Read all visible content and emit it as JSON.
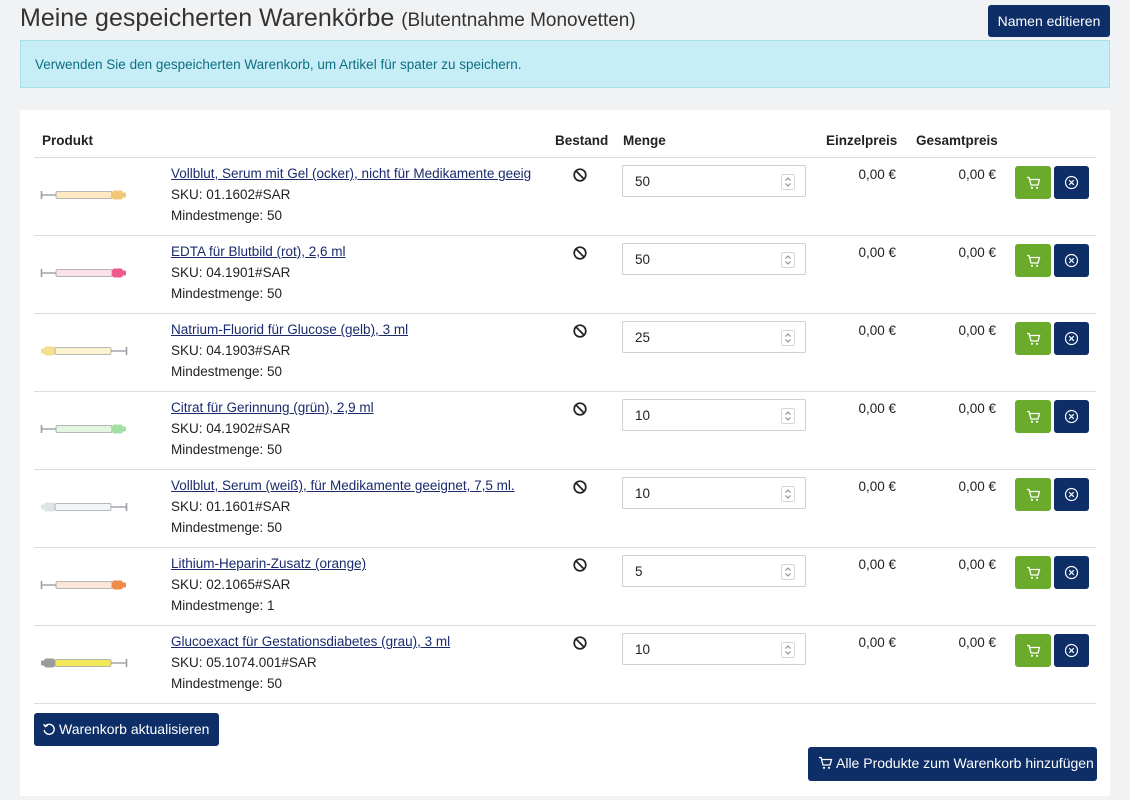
{
  "header": {
    "title": "Meine gespeicherten Warenkörbe",
    "subtitle": "(Blutentnahme Monovetten)",
    "edit_name_label": "Namen editieren"
  },
  "alert": {
    "text": "Verwenden Sie den gespeicherten Warenkorb, um Artikel für spater zu speichern."
  },
  "table": {
    "headers": {
      "product": "Produkt",
      "stock": "Bestand",
      "quantity": "Menge",
      "unit_price": "Einzelpreis",
      "total_price": "Gesamtpreis"
    },
    "rows": [
      {
        "name": "Vollblut, Serum mit Gel (ocker), nicht für Medikamente geeig",
        "sku": "SKU: 01.1602#SAR",
        "min": "Mindestmenge: 50",
        "qty": "50",
        "unit": "0,00 €",
        "total": "0,00 €",
        "cap_color": "#f0c878",
        "body_color": "#fde8c2",
        "cap_side": "right"
      },
      {
        "name": "EDTA für Blutbild (rot), 2,6 ml",
        "sku": "SKU: 04.1901#SAR",
        "min": "Mindestmenge: 50",
        "qty": "50",
        "unit": "0,00 €",
        "total": "0,00 €",
        "cap_color": "#ee5a8c",
        "body_color": "#fbe2ea",
        "cap_side": "right"
      },
      {
        "name": "Natrium-Fluorid für Glucose (gelb), 3 ml",
        "sku": "SKU: 04.1903#SAR",
        "min": "Mindestmenge: 50",
        "qty": "25",
        "unit": "0,00 €",
        "total": "0,00 €",
        "cap_color": "#f3df8e",
        "body_color": "#fbf2cf",
        "cap_side": "left"
      },
      {
        "name": "Citrat für Gerinnung (grün), 2,9 ml",
        "sku": "SKU: 04.1902#SAR",
        "min": "Mindestmenge: 50",
        "qty": "10",
        "unit": "0,00 €",
        "total": "0,00 €",
        "cap_color": "#a6dfa6",
        "body_color": "#e2f6e2",
        "cap_side": "right"
      },
      {
        "name": "Vollblut, Serum (weiß), für Medikamente geeignet, 7,5 ml.",
        "sku": "SKU: 01.1601#SAR",
        "min": "Mindestmenge: 50",
        "qty": "10",
        "unit": "0,00 €",
        "total": "0,00 €",
        "cap_color": "#dde4e6",
        "body_color": "#f1f5f6",
        "cap_side": "left"
      },
      {
        "name": "Lithium-Heparin-Zusatz (orange)",
        "sku": "SKU: 02.1065#SAR",
        "min": "Mindestmenge: 1",
        "qty": "5",
        "unit": "0,00 €",
        "total": "0,00 €",
        "cap_color": "#f08a4a",
        "body_color": "#fbe7da",
        "cap_side": "right"
      },
      {
        "name": "Glucoexact für Gestationsdiabetes (grau), 3 ml",
        "sku": "SKU: 05.1074.001#SAR",
        "min": "Mindestmenge: 50",
        "qty": "10",
        "unit": "0,00 €",
        "total": "0,00 €",
        "cap_color": "#9a9a9a",
        "body_color": "#f2e85a",
        "cap_side": "left"
      }
    ]
  },
  "actions": {
    "update_label": "Warenkorb aktualisieren",
    "add_all_label": "Alle Produkte zum Warenkorb hinzufügen"
  },
  "icons": {
    "stock": "not-available-icon",
    "cart": "cart-icon",
    "remove": "remove-circle-icon",
    "refresh": "refresh-icon"
  },
  "colors": {
    "primary": "#0d2e66",
    "success": "#6aab2c",
    "info_bg": "#c7eef6",
    "info_text": "#0e6f82",
    "link": "#1a2a6c"
  }
}
